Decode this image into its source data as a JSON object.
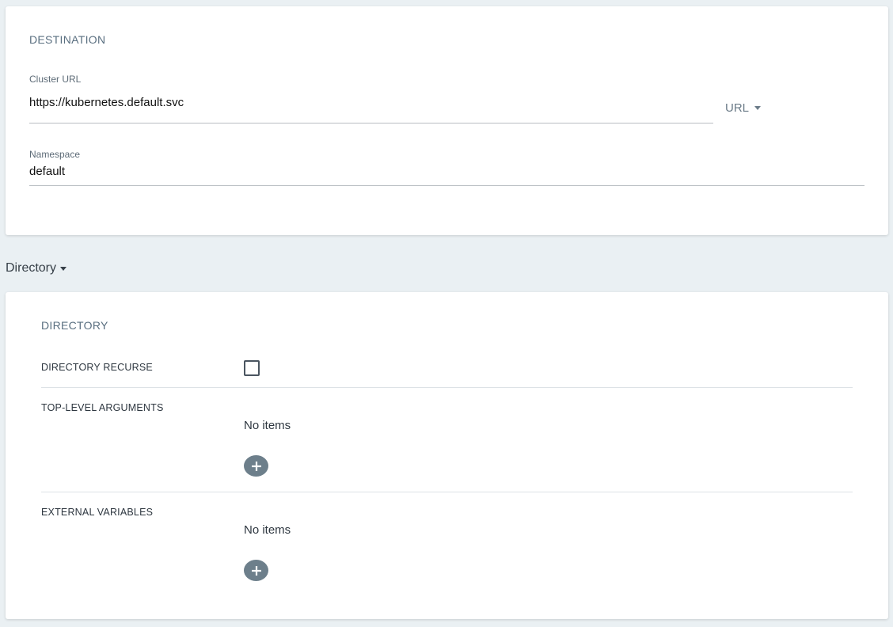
{
  "destination": {
    "title": "DESTINATION",
    "cluster_url_label": "Cluster URL",
    "cluster_url_value": "https://kubernetes.default.svc",
    "url_type_label": "URL",
    "namespace_label": "Namespace",
    "namespace_value": "default"
  },
  "source_type_label": "Directory",
  "directory": {
    "title": "DIRECTORY",
    "recurse_label": "DIRECTORY RECURSE",
    "recurse_checked": false,
    "top_level_args_label": "TOP-LEVEL ARGUMENTS",
    "top_level_args_empty": "No items",
    "external_vars_label": "EXTERNAL VARIABLES",
    "external_vars_empty": "No items"
  },
  "icons": {
    "dropdown": "caret-down-icon",
    "add": "plus-icon"
  },
  "colors": {
    "background": "#eaf0f3",
    "add_button": "#6d7f8b",
    "section_title": "#5a6f80"
  }
}
